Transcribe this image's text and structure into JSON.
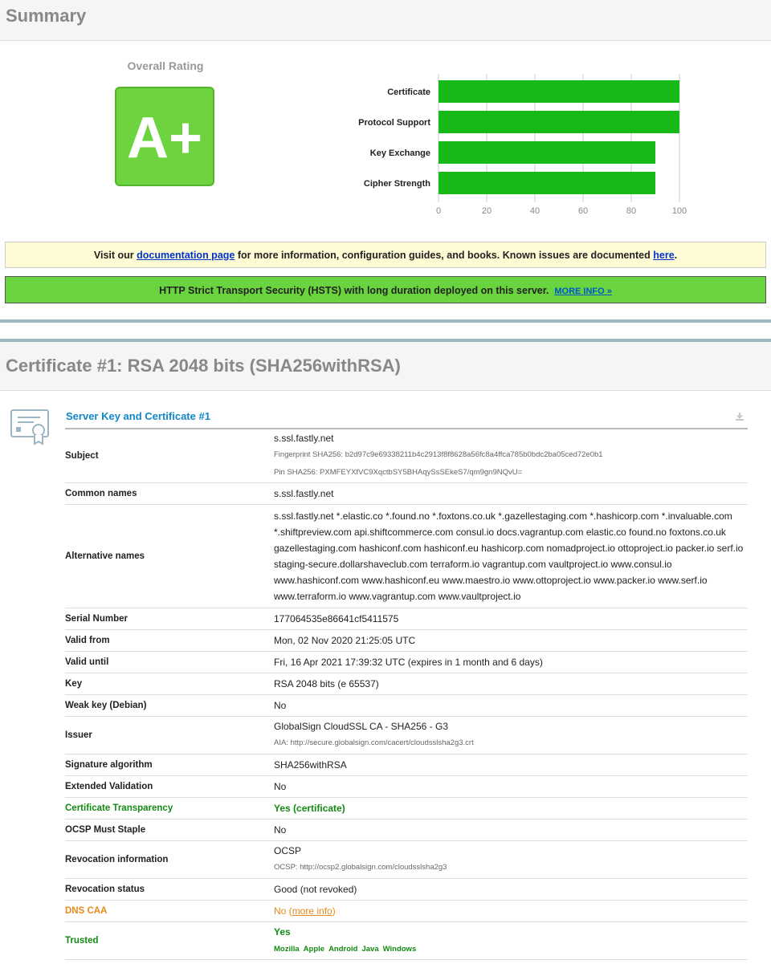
{
  "summary": {
    "title": "Summary",
    "overall_rating_label": "Overall Rating",
    "grade": "A+",
    "documentation_notice": {
      "prefix": "Visit our ",
      "doc_link": "documentation page",
      "middle": " for more information, configuration guides, and books. Known issues are documented ",
      "here_link": "here",
      "suffix": "."
    },
    "hsts_notice": {
      "text": "HTTP Strict Transport Security (HSTS) with long duration deployed on this server.",
      "link": "MORE INFO »"
    }
  },
  "chart_data": {
    "type": "bar",
    "orientation": "horizontal",
    "categories": [
      "Certificate",
      "Protocol Support",
      "Key Exchange",
      "Cipher Strength"
    ],
    "values": [
      100,
      100,
      90,
      90
    ],
    "xlim": [
      0,
      100
    ],
    "xticks": [
      "0",
      "20",
      "40",
      "60",
      "80",
      "100"
    ],
    "bar_color": "#17b817",
    "grid": true
  },
  "certificate": {
    "heading": "Certificate #1: RSA 2048 bits (SHA256withRSA)",
    "panel_title": "Server Key and Certificate #1",
    "rows": [
      {
        "key": "Subject",
        "value": "s.ssl.fastly.net",
        "subs": [
          "Fingerprint SHA256: b2d97c9e69338211b4c2913f8f8628a56fc8a4ffca785b0bdc2ba05ced72e0b1",
          "Pin SHA256: PXMFEYXfVC9XqctbSY5BHAqySsSEkeS7/qm9gn9NQvU="
        ]
      },
      {
        "key": "Common names",
        "value": "s.ssl.fastly.net"
      },
      {
        "key": "Alternative names",
        "value": "s.ssl.fastly.net *.elastic.co *.found.no *.foxtons.co.uk *.gazellestaging.com *.hashicorp.com *.invaluable.com *.shiftpreview.com api.shiftcommerce.com consul.io docs.vagrantup.com elastic.co found.no foxtons.co.uk gazellestaging.com hashiconf.com hashiconf.eu hashicorp.com nomadproject.io ottoproject.io packer.io serf.io staging-secure.dollarshaveclub.com terraform.io vagrantup.com vaultproject.io www.consul.io www.hashiconf.com www.hashiconf.eu www.maestro.io www.ottoproject.io www.packer.io www.serf.io www.terraform.io www.vagrantup.com www.vaultproject.io"
      },
      {
        "key": "Serial Number",
        "value": "177064535e86641cf5411575"
      },
      {
        "key": "Valid from",
        "value": "Mon, 02 Nov 2020 21:25:05 UTC"
      },
      {
        "key": "Valid until",
        "value": "Fri, 16 Apr 2021 17:39:32 UTC (expires in 1 month and 6 days)"
      },
      {
        "key": "Key",
        "value": "RSA 2048 bits (e 65537)"
      },
      {
        "key": "Weak key (Debian)",
        "value": "No"
      },
      {
        "key": "Issuer",
        "value": "GlobalSign CloudSSL CA - SHA256 - G3",
        "subs": [
          "AIA: http://secure.globalsign.com/cacert/cloudsslsha2g3.crt"
        ]
      },
      {
        "key": "Signature algorithm",
        "value": "SHA256withRSA"
      },
      {
        "key": "Extended Validation",
        "value": "No"
      },
      {
        "key": "Certificate Transparency",
        "value": "Yes (certificate)",
        "style": "green"
      },
      {
        "key": "OCSP Must Staple",
        "value": "No"
      },
      {
        "key": "Revocation information",
        "value": "OCSP",
        "subs": [
          "OCSP: http://ocsp2.globalsign.com/cloudsslsha2g3"
        ]
      },
      {
        "key": "Revocation status",
        "value": "Good (not revoked)"
      },
      {
        "key": "DNS CAA",
        "value": "No",
        "link": "more info",
        "style": "orange"
      },
      {
        "key": "Trusted",
        "value": "Yes",
        "style": "green",
        "trusted_by": [
          "Mozilla",
          "Apple",
          "Android",
          "Java",
          "Windows"
        ]
      }
    ]
  },
  "colors": {
    "grade_bg": "#6dd33f",
    "bar": "#17b817",
    "link_blue": "#1287c8",
    "green_text": "#138a13",
    "orange_text": "#e68a1a",
    "hsts_bg": "#6ad43e",
    "notice_bg": "#fffbd5"
  }
}
